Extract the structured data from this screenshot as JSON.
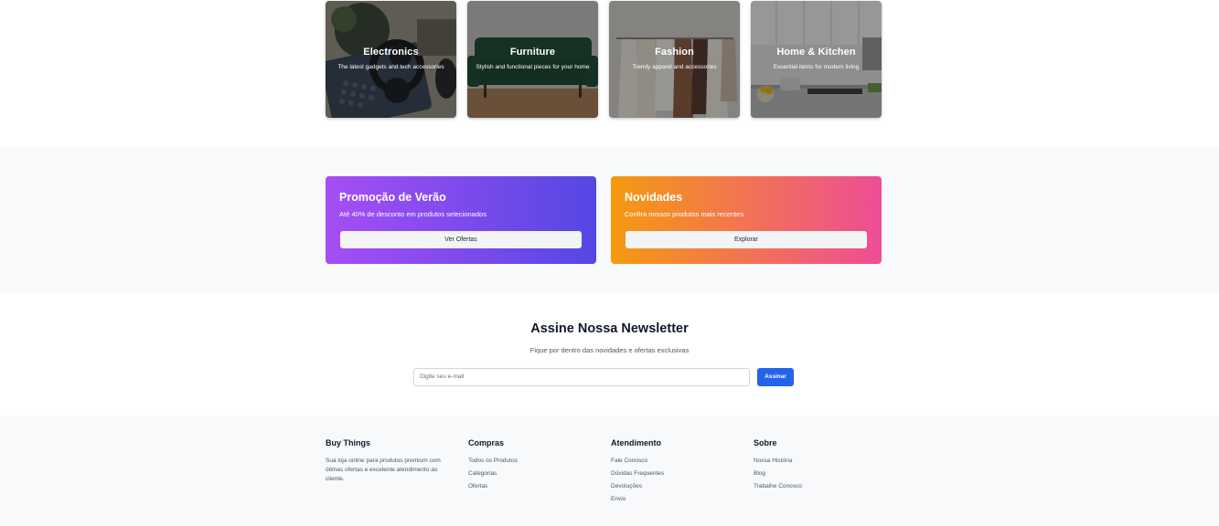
{
  "categories": [
    {
      "title": "Electronics",
      "subtitle": "The latest gadgets and tech accessories",
      "icon": "electronics-image"
    },
    {
      "title": "Furniture",
      "subtitle": "Stylish and functional pieces for your home",
      "icon": "furniture-image"
    },
    {
      "title": "Fashion",
      "subtitle": "Trendy apparel and accessories",
      "icon": "fashion-image"
    },
    {
      "title": "Home & Kitchen",
      "subtitle": "Essential items for modern living",
      "icon": "kitchen-image"
    }
  ],
  "promos": [
    {
      "title": "Promoção de Verão",
      "subtitle": "Até 40% de desconto em produtos selecionados",
      "button": "Ver Ofertas"
    },
    {
      "title": "Novidades",
      "subtitle": "Confira nossos produtos mais recentes",
      "button": "Explorar"
    }
  ],
  "newsletter": {
    "title": "Assine Nossa Newsletter",
    "subtitle": "Fique por dentro das novidades e ofertas exclusivas",
    "placeholder": "Digite seu e-mail",
    "button": "Assinar"
  },
  "footer": {
    "brand": {
      "title": "Buy Things",
      "description": "Sua loja online para produtos premium com ótimas ofertas e excelente atendimento ao cliente."
    },
    "compras": {
      "title": "Compras",
      "links": [
        "Todos os Produtos",
        "Categorias",
        "Ofertas"
      ]
    },
    "atendimento": {
      "title": "Atendimento",
      "links": [
        "Fale Conosco",
        "Dúvidas Frequentes",
        "Devoluções",
        "Envio"
      ]
    },
    "sobre": {
      "title": "Sobre",
      "links": [
        "Nossa História",
        "Blog",
        "Trabalhe Conosco"
      ]
    }
  },
  "colors": {
    "promo1_start": "#a64ef5",
    "promo1_end": "#5547e3",
    "promo2_start": "#f59a10",
    "promo2_end": "#ee4d96",
    "accent": "#2563eb"
  }
}
